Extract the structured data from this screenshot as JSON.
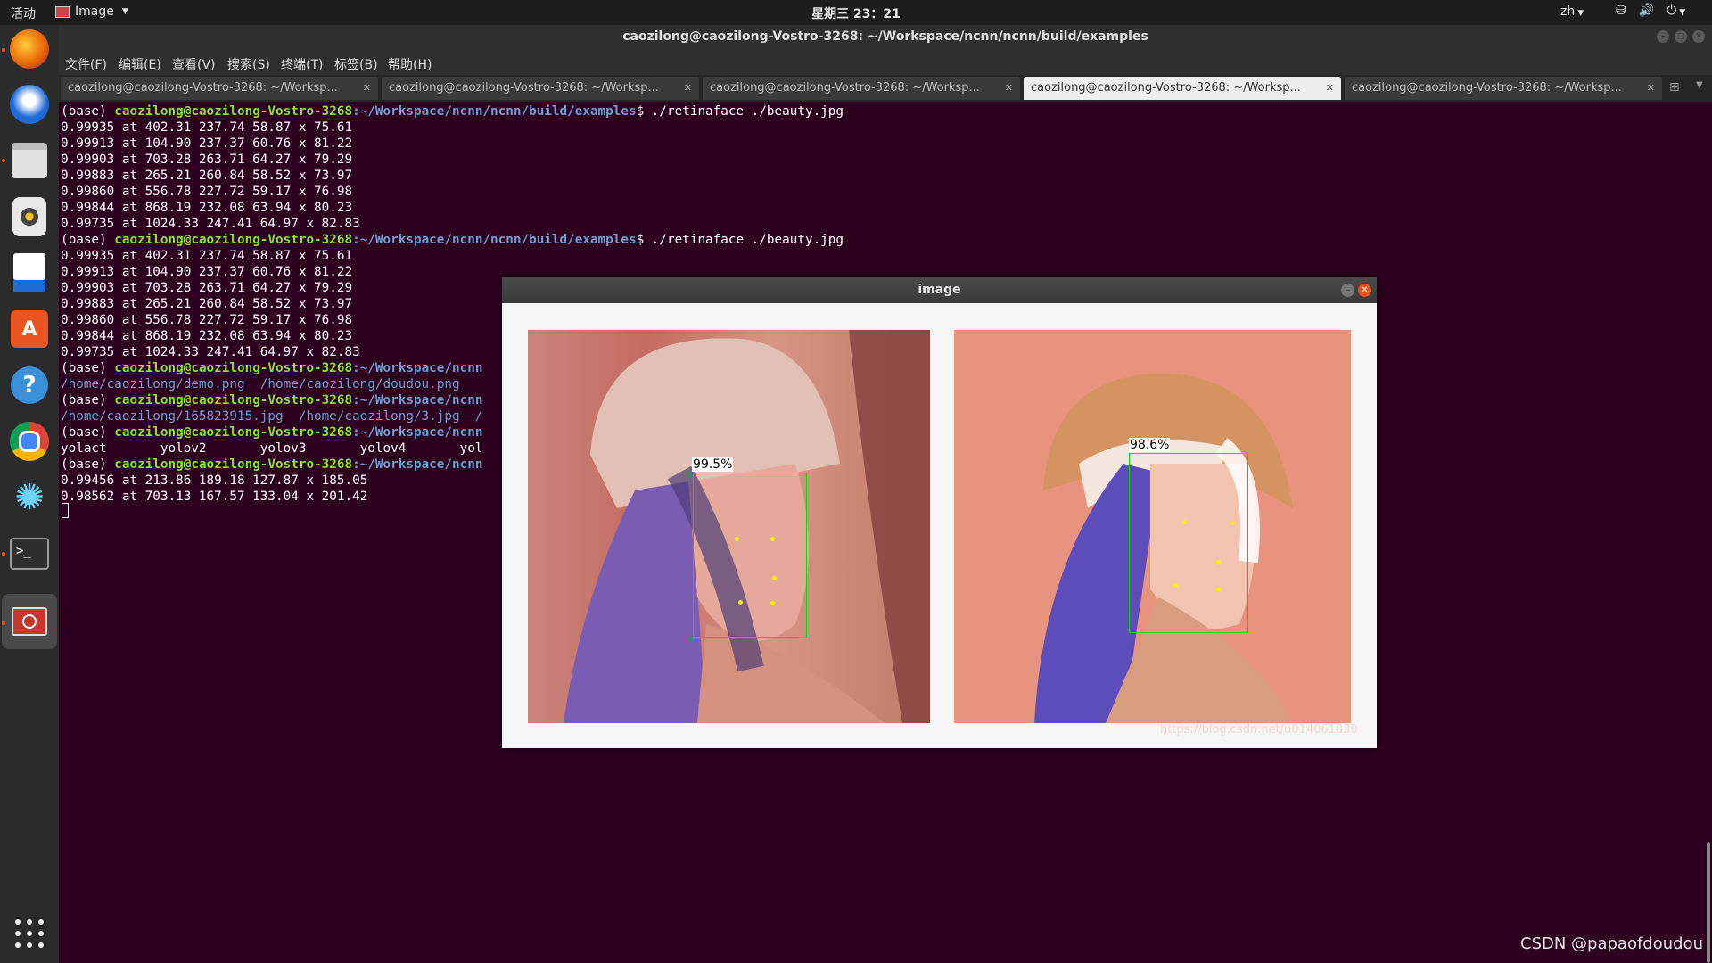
{
  "topbar": {
    "activities": "活动",
    "app_menu": "Image",
    "clock": "星期三 23：21",
    "lang": "zh"
  },
  "window": {
    "title": "caozilong@caozilong-Vostro-3268: ~/Workspace/ncnn/ncnn/build/examples"
  },
  "menu": [
    "文件(F)",
    "编辑(E)",
    "查看(V)",
    "搜索(S)",
    "终端(T)",
    "标签(B)",
    "帮助(H)"
  ],
  "tabs": [
    {
      "label": "caozilong@caozilong-Vostro-3268: ~/Worksp...",
      "active": false
    },
    {
      "label": "caozilong@caozilong-Vostro-3268: ~/Worksp...",
      "active": false
    },
    {
      "label": "caozilong@caozilong-Vostro-3268: ~/Worksp...",
      "active": false
    },
    {
      "label": "caozilong@caozilong-Vostro-3268: ~/Worksp...",
      "active": true
    },
    {
      "label": "caozilong@caozilong-Vostro-3268: ~/Worksp...",
      "active": false
    }
  ],
  "terminal": {
    "prompt_env": "(base) ",
    "prompt_user": "caozilong@caozilong-Vostro-3268",
    "lines": [
      {
        "path": ":~/Workspace/ncnn/ncnn/build/examples",
        "cmd": "$ ./retinaface ./beauty.jpg"
      },
      {
        "text": "0.99935 at 402.31 237.74 58.87 x 75.61"
      },
      {
        "text": "0.99913 at 104.90 237.37 60.76 x 81.22"
      },
      {
        "text": "0.99903 at 703.28 263.71 64.27 x 79.29"
      },
      {
        "text": "0.99883 at 265.21 260.84 58.52 x 73.97"
      },
      {
        "text": "0.99860 at 556.78 227.72 59.17 x 76.98"
      },
      {
        "text": "0.99844 at 868.19 232.08 63.94 x 80.23"
      },
      {
        "text": "0.99735 at 1024.33 247.41 64.97 x 82.83"
      },
      {
        "path": ":~/Workspace/ncnn/ncnn/build/examples",
        "cmd": "$ ./retinaface ./beauty.jpg"
      },
      {
        "text": "0.99935 at 402.31 237.74 58.87 x 75.61"
      },
      {
        "text": "0.99913 at 104.90 237.37 60.76 x 81.22"
      },
      {
        "text": "0.99903 at 703.28 263.71 64.27 x 79.29"
      },
      {
        "text": "0.99883 at 265.21 260.84 58.52 x 73.97"
      },
      {
        "text": "0.99860 at 556.78 227.72 59.17 x 76.98"
      },
      {
        "text": "0.99844 at 868.19 232.08 63.94 x 80.23"
      },
      {
        "text": "0.99735 at 1024.33 247.41 64.97 x 82.83"
      },
      {
        "path": ":~/Workspace/ncnn",
        "cmd": ""
      },
      {
        "pathtext": "/home/caozilong/demo.png  /home/caozilong/doudou.png"
      },
      {
        "path": ":~/Workspace/ncnn",
        "cmd": ""
      },
      {
        "pathtext": "/home/caozilong/165823915.jpg  /home/caozilong/3.jpg  /"
      },
      {
        "path": ":~/Workspace/ncnn",
        "cmd": ""
      },
      {
        "text": "yolact       yolov2       yolov3       yolov4       yol"
      },
      {
        "path": ":~/Workspace/ncnn",
        "cmd": ""
      },
      {
        "text": "0.99456 at 213.86 189.18 127.87 x 185.05"
      },
      {
        "text": "0.98562 at 703.13 167.57 133.04 x 201.42"
      }
    ]
  },
  "image_window": {
    "title": "image",
    "left_confidence": "99.5%",
    "right_confidence": "98.6%",
    "watermark": "https://blog.csdn.net/u014061830"
  },
  "watermark": "CSDN @papaofdoudou",
  "icons": {
    "dock": [
      "firefox-icon",
      "thunderbird-icon",
      "files-icon",
      "rhythmbox-icon",
      "writer-icon",
      "software-center-icon",
      "help-icon",
      "chrome-icon",
      "settings-icon",
      "terminal-icon",
      "image-viewer-icon",
      "app-grid-icon"
    ]
  },
  "colors": {
    "terminal_bg": "#2c001e",
    "prompt_user": "#8ae234",
    "prompt_path": "#729fcf",
    "ubuntu_orange": "#e95420",
    "facebox": "#00e000",
    "landmark": "#ffee00"
  }
}
